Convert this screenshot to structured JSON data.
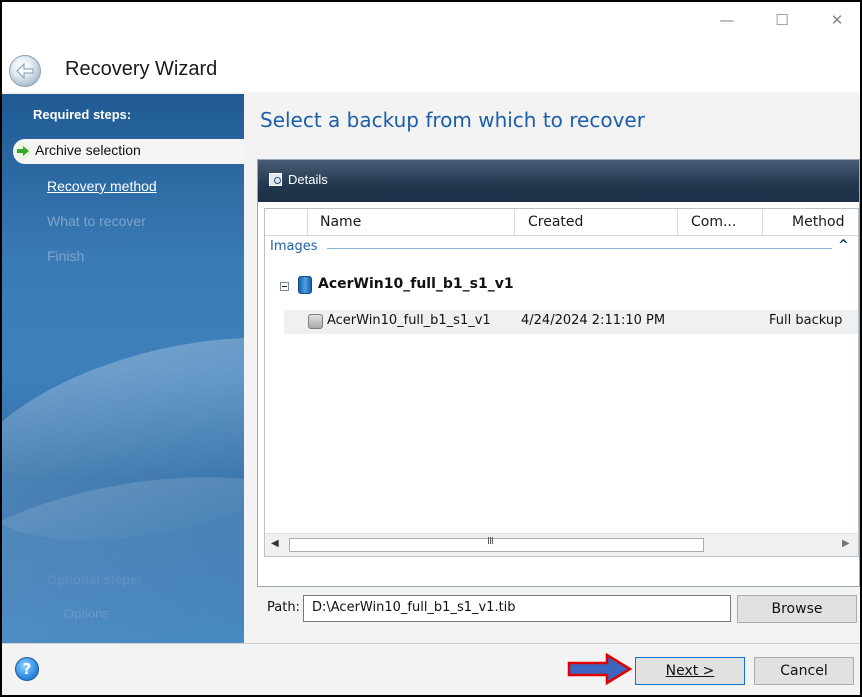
{
  "window": {
    "title": "Recovery Wizard",
    "minimize_glyph": "—",
    "maximize_glyph": "☐",
    "close_glyph": "✕"
  },
  "sidebar": {
    "required_heading": "Required steps:",
    "items": [
      {
        "label": "Archive selection",
        "state": "active"
      },
      {
        "label": "Recovery method",
        "state": "link"
      },
      {
        "label": "What to recover",
        "state": "disabled"
      },
      {
        "label": "Finish",
        "state": "disabled"
      }
    ],
    "optional_heading": "Optional steps:",
    "optional_items": [
      {
        "label": "Options",
        "state": "disabled"
      }
    ]
  },
  "content": {
    "title": "Select a backup from which to recover"
  },
  "details_panel": {
    "label": "Details",
    "columns": [
      "Name",
      "Created",
      "Com...",
      "Method"
    ],
    "group_label": "Images",
    "archive": {
      "name": "AcerWin10_full_b1_s1_v1"
    },
    "rows": [
      {
        "name": "AcerWin10_full_b1_s1_v1",
        "created": "4/24/2024 2:11:10 PM",
        "comment": "",
        "method": "Full backup"
      }
    ],
    "scroll_grip": "III"
  },
  "path": {
    "label": "Path:",
    "value": "D:\\AcerWin10_full_b1_s1_v1.tib",
    "browse_label": "Browse"
  },
  "footer": {
    "help_glyph": "?",
    "next_label": "Next >",
    "cancel_label": "Cancel",
    "annotation_arrow_color": "#e00000",
    "annotation_arrow_fill": "#3a66c0"
  },
  "colors": {
    "sidebar_blue": "#3a7ab5",
    "title_blue": "#1c5ea8",
    "panel_header": "#22384f"
  },
  "icons": [
    "back-arrow-icon",
    "green-arrow-icon",
    "details-icon",
    "archive-icon",
    "disk-image-icon",
    "help-icon"
  ]
}
